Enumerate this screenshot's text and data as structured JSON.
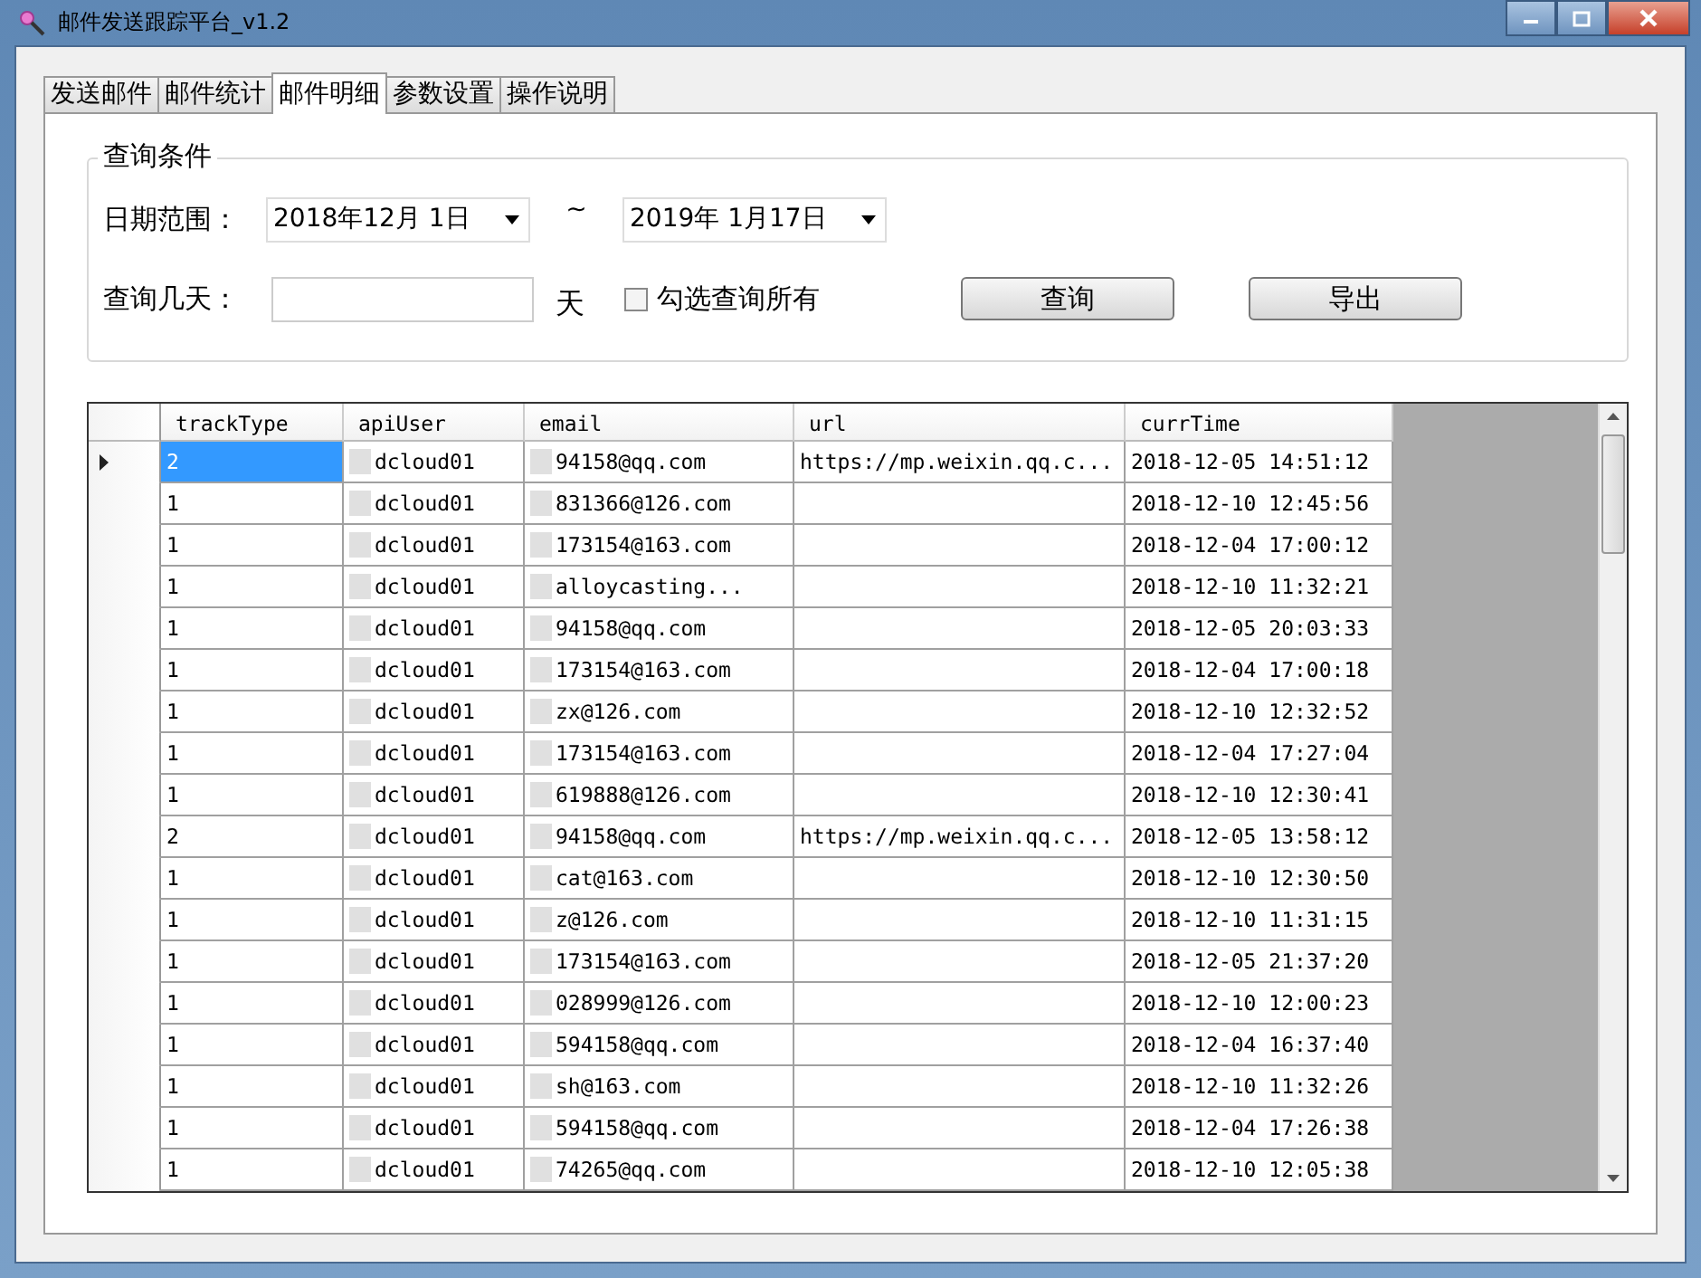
{
  "window": {
    "title": "邮件发送跟踪平台_v1.2"
  },
  "tabs": [
    {
      "label": "发送邮件",
      "selected": false
    },
    {
      "label": "邮件统计",
      "selected": false
    },
    {
      "label": "邮件明细",
      "selected": true
    },
    {
      "label": "参数设置",
      "selected": false
    },
    {
      "label": "操作说明",
      "selected": false
    }
  ],
  "query_group": {
    "title": "查询条件",
    "date_label": "日期范围：",
    "start_date": "2018年12月 1日",
    "separator": "~",
    "end_date": "2019年 1月17日",
    "days_label": "查询几天：",
    "days_unit": "天",
    "query_all": {
      "label": "勾选查询所有",
      "checked": false
    },
    "buttons": [
      "查询",
      "导出"
    ]
  },
  "table": {
    "columns": [
      "trackType",
      "apiUser",
      "email",
      "url",
      "currTime"
    ],
    "rows": [
      {
        "selected": true,
        "cells": [
          "2",
          "dcloud01",
          "94158@qq.com",
          "https://mp.weixin.qq.c...",
          "2018-12-05 14:51:12"
        ]
      },
      {
        "selected": false,
        "cells": [
          "1",
          "dcloud01",
          "831366@126.com",
          "",
          "2018-12-10 12:45:56"
        ]
      },
      {
        "selected": false,
        "cells": [
          "1",
          "dcloud01",
          "173154@163.com",
          "",
          "2018-12-04 17:00:12"
        ]
      },
      {
        "selected": false,
        "cells": [
          "1",
          "dcloud01",
          "alloycasting...",
          "",
          "2018-12-10 11:32:21"
        ]
      },
      {
        "selected": false,
        "cells": [
          "1",
          "dcloud01",
          "94158@qq.com",
          "",
          "2018-12-05 20:03:33"
        ]
      },
      {
        "selected": false,
        "cells": [
          "1",
          "dcloud01",
          "173154@163.com",
          "",
          "2018-12-04 17:00:18"
        ]
      },
      {
        "selected": false,
        "cells": [
          "1",
          "dcloud01",
          "zx@126.com",
          "",
          "2018-12-10 12:32:52"
        ]
      },
      {
        "selected": false,
        "cells": [
          "1",
          "dcloud01",
          "173154@163.com",
          "",
          "2018-12-04 17:27:04"
        ]
      },
      {
        "selected": false,
        "cells": [
          "1",
          "dcloud01",
          "619888@126.com",
          "",
          "2018-12-10 12:30:41"
        ]
      },
      {
        "selected": false,
        "cells": [
          "2",
          "dcloud01",
          "94158@qq.com",
          "https://mp.weixin.qq.c...",
          "2018-12-05 13:58:12"
        ]
      },
      {
        "selected": false,
        "cells": [
          "1",
          "dcloud01",
          "cat@163.com",
          "",
          "2018-12-10 12:30:50"
        ]
      },
      {
        "selected": false,
        "cells": [
          "1",
          "dcloud01",
          "z@126.com",
          "",
          "2018-12-10 11:31:15"
        ]
      },
      {
        "selected": false,
        "cells": [
          "1",
          "dcloud01",
          "173154@163.com",
          "",
          "2018-12-05 21:37:20"
        ]
      },
      {
        "selected": false,
        "cells": [
          "1",
          "dcloud01",
          "028999@126.com",
          "",
          "2018-12-10 12:00:23"
        ]
      },
      {
        "selected": false,
        "cells": [
          "1",
          "dcloud01",
          "594158@qq.com",
          "",
          "2018-12-04 16:37:40"
        ]
      },
      {
        "selected": false,
        "cells": [
          "1",
          "dcloud01",
          "sh@163.com",
          "",
          "2018-12-10 11:32:26"
        ]
      },
      {
        "selected": false,
        "cells": [
          "1",
          "dcloud01",
          "594158@qq.com",
          "",
          "2018-12-04 17:26:38"
        ]
      },
      {
        "selected": false,
        "cells": [
          "1",
          "dcloud01",
          "74265@qq.com",
          "",
          "2018-12-10 12:05:38"
        ]
      }
    ]
  }
}
